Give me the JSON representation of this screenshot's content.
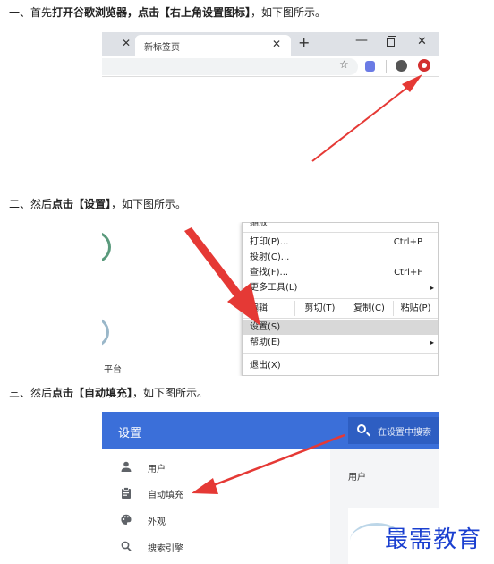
{
  "steps": [
    {
      "prefix": "一、首先",
      "bold": "打开谷歌浏览器，点击【右上角设置图标】",
      "suffix": "，如下图所示。"
    },
    {
      "prefix": "二、然后",
      "bold": "点击【设置】",
      "suffix": "，如下图所示。"
    },
    {
      "prefix": "三、然后",
      "bold": "点击【自动填充】",
      "suffix": "，如下图所示。"
    }
  ],
  "browser": {
    "tab_title": "新标签页",
    "close_glyph": "✕",
    "new_tab_glyph": "+",
    "minimize_glyph": "—",
    "close_window_glyph": "✕",
    "star_glyph": "☆",
    "accent_color": "#d32f2f"
  },
  "menu": {
    "top_cut": "缩放",
    "items": [
      {
        "label": "打印(P)...",
        "shortcut": "Ctrl+P"
      },
      {
        "label": "投射(C)...",
        "shortcut": ""
      },
      {
        "label": "查找(F)...",
        "shortcut": "Ctrl+F"
      },
      {
        "label": "更多工具(L)",
        "shortcut": "",
        "chevron": "▸"
      }
    ],
    "edit_row": {
      "label": "编辑",
      "cut": "剪切(T)",
      "copy": "复制(C)",
      "paste": "粘贴(P)"
    },
    "settings": "设置(S)",
    "help": "帮助(E)",
    "help_chevron": "▸",
    "exit": "退出(X)",
    "left_partial_text": "平台"
  },
  "settings_page": {
    "header_title": "设置",
    "search_placeholder": "在设置中搜索",
    "header_color": "#3b6fd9",
    "nav": [
      {
        "label": "用户",
        "icon": "person-icon"
      },
      {
        "label": "自动填充",
        "icon": "clipboard-icon"
      },
      {
        "label": "外观",
        "icon": "palette-icon"
      },
      {
        "label": "搜索引擎",
        "icon": "search-icon"
      }
    ],
    "content_title": "用户"
  },
  "watermark": "最需教育",
  "arrow_color": "#e53935"
}
